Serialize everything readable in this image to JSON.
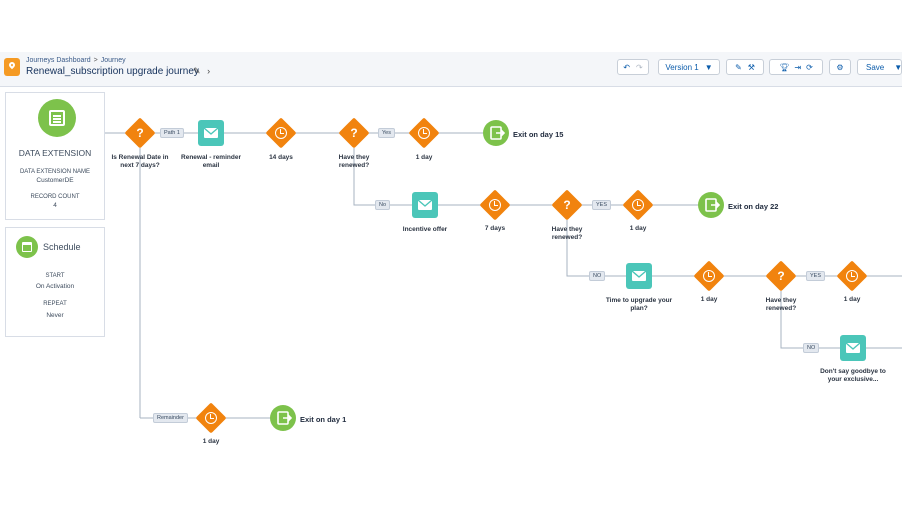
{
  "header": {
    "breadcrumb": [
      "Journeys Dashboard",
      "Journey"
    ],
    "breadcrumb_sep": ">",
    "title": "Renewal_subscription upgrade journey",
    "version_label": "Version 1",
    "save_label": "Save"
  },
  "data_extension": {
    "heading": "DATA EXTENSION",
    "name_label": "DATA EXTENSION NAME",
    "name_value": "CustomerDE",
    "count_label": "RECORD COUNT",
    "count_value": "4"
  },
  "schedule": {
    "heading": "Schedule",
    "start_label": "START",
    "start_value": "On Activation",
    "repeat_label": "REPEAT",
    "repeat_value": "Never"
  },
  "canvas": {
    "decision1": "Is Renewal Date in next 7 days?",
    "path1": "Path 1",
    "remainder": "Remainder",
    "email1": "Renewal - reminder email",
    "wait1": "14 days",
    "decision2": "Have they renewed?",
    "yes1": "Yes",
    "no1": "No",
    "wait2": "1 day",
    "exit1": "Exit on day 15",
    "email2": "Incentive offer",
    "wait3": "7 days",
    "decision3": "Have they renewed?",
    "yes2": "YES",
    "no2": "NO",
    "wait4": "1 day",
    "exit2": "Exit on day 22",
    "email3": "Time to upgrade your plan?",
    "wait5": "1 day",
    "decision4": "Have they renewed?",
    "yes3": "YES",
    "no3": "NO",
    "wait6": "1 day",
    "email4": "Don't say goodbye to your exclusive...",
    "wait7": "1 day",
    "exit3": "Exit on day 1"
  },
  "colors": {
    "decision": "#f1830e",
    "email": "#4bc6b9",
    "exit": "#7dc24b",
    "source": "#7dc24b"
  }
}
